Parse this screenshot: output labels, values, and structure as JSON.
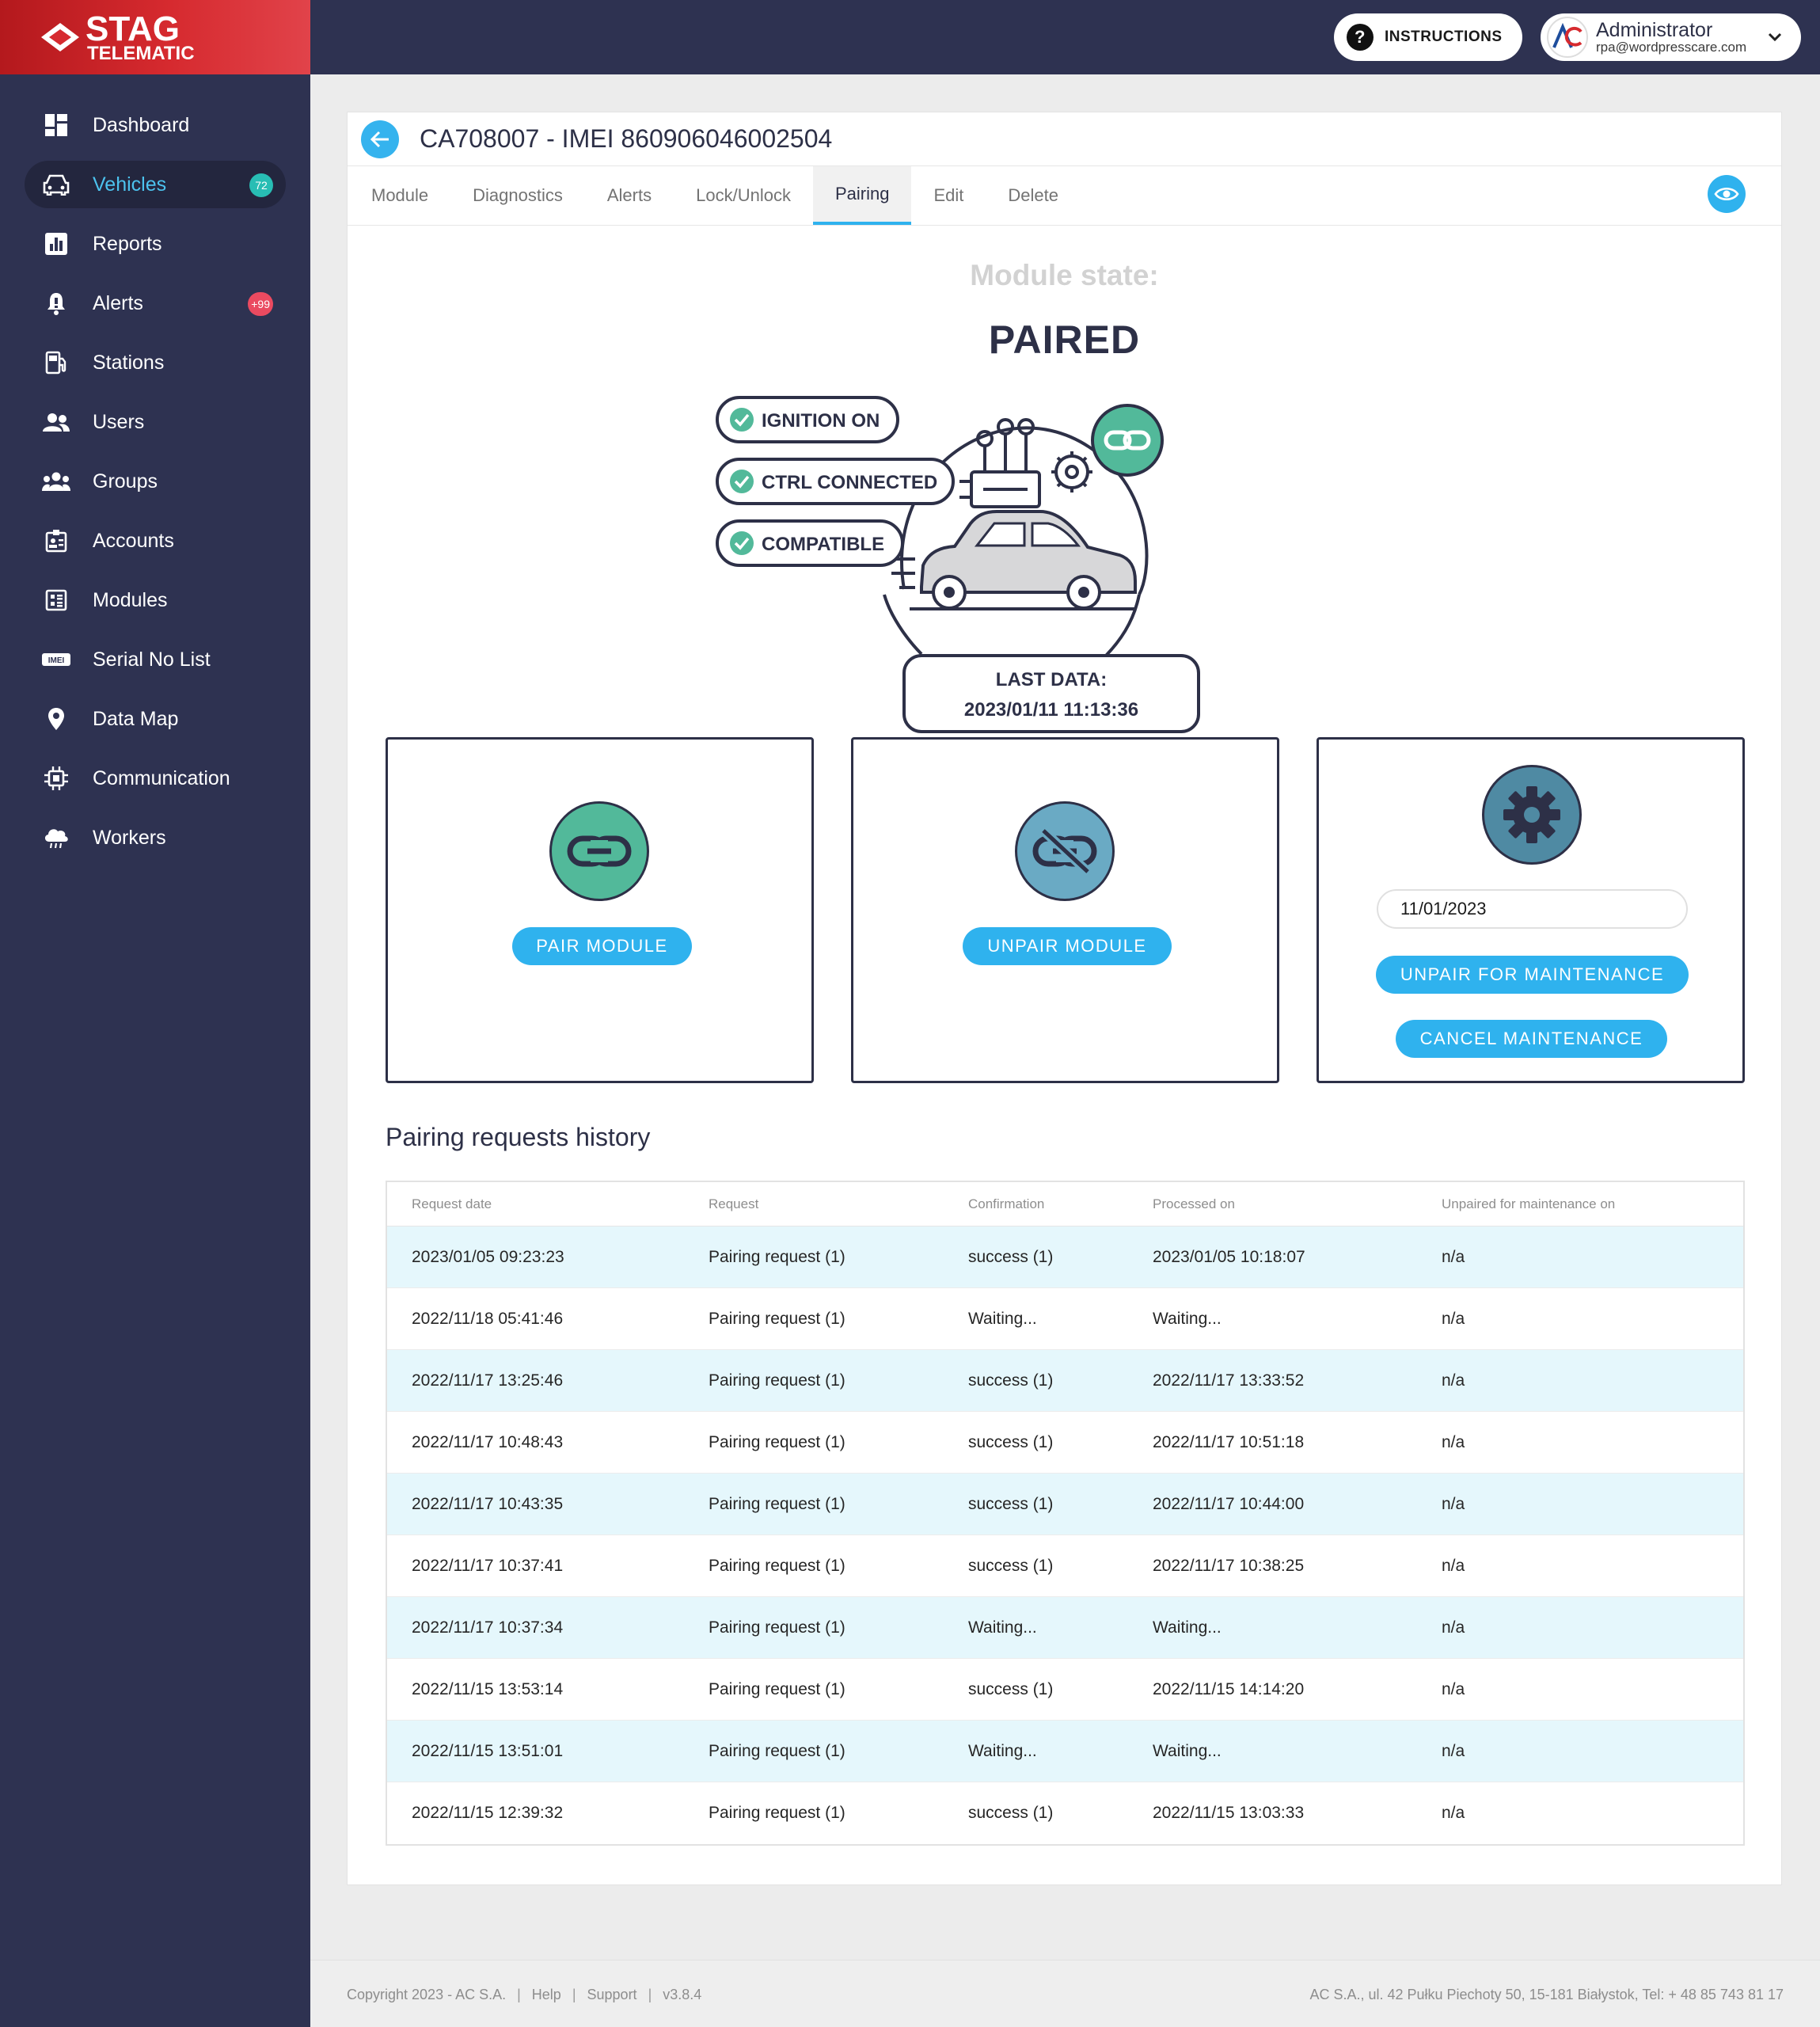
{
  "brand": {
    "line1": "STAG",
    "line2": "TELEMATIC"
  },
  "sidebar": {
    "items": [
      {
        "label": "Dashboard",
        "icon": "dashboard-icon"
      },
      {
        "label": "Vehicles",
        "icon": "car-icon",
        "badge": "72",
        "active": true
      },
      {
        "label": "Reports",
        "icon": "bar-chart-icon"
      },
      {
        "label": "Alerts",
        "icon": "bell-icon",
        "badge": "+99"
      },
      {
        "label": "Stations",
        "icon": "fuel-station-icon"
      },
      {
        "label": "Users",
        "icon": "users-icon"
      },
      {
        "label": "Groups",
        "icon": "groups-icon"
      },
      {
        "label": "Accounts",
        "icon": "id-card-icon"
      },
      {
        "label": "Modules",
        "icon": "module-icon"
      },
      {
        "label": "Serial No List",
        "icon": "imei-icon"
      },
      {
        "label": "Data Map",
        "icon": "map-pin-icon"
      },
      {
        "label": "Communication",
        "icon": "chip-icon"
      },
      {
        "label": "Workers",
        "icon": "cloud-icon"
      }
    ],
    "imei_icon_text": "IMEI"
  },
  "topbar": {
    "instructions_label": "INSTRUCTIONS",
    "user_name": "Administrator",
    "user_email": "rpa@wordpresscare.com"
  },
  "page": {
    "title": "CA708007 - IMEI 860906046002504",
    "tabs": [
      "Module",
      "Diagnostics",
      "Alerts",
      "Lock/Unlock",
      "Pairing",
      "Edit",
      "Delete"
    ],
    "active_tab": "Pairing"
  },
  "module_state": {
    "label": "Module state:",
    "value": "PAIRED",
    "checks": [
      "IGNITION ON",
      "CTRL CONNECTED",
      "COMPATIBLE"
    ],
    "last_data_label": "LAST DATA:",
    "last_data_value": "2023/01/11 11:13:36"
  },
  "actions": {
    "pair_label": "PAIR MODULE",
    "unpair_label": "UNPAIR MODULE",
    "maintenance_date": "11/01/2023",
    "unpair_maintenance_label": "UNPAIR FOR MAINTENANCE",
    "cancel_maintenance_label": "CANCEL MAINTENANCE"
  },
  "history": {
    "title": "Pairing requests history",
    "columns": [
      "Request date",
      "Request",
      "Confirmation",
      "Processed on",
      "Unpaired for maintenance on"
    ],
    "rows": [
      [
        "2023/01/05 09:23:23",
        "Pairing request (1)",
        "success (1)",
        "2023/01/05 10:18:07",
        "n/a"
      ],
      [
        "2022/11/18 05:41:46",
        "Pairing request (1)",
        "Waiting...",
        "Waiting...",
        "n/a"
      ],
      [
        "2022/11/17 13:25:46",
        "Pairing request (1)",
        "success (1)",
        "2022/11/17 13:33:52",
        "n/a"
      ],
      [
        "2022/11/17 10:48:43",
        "Pairing request (1)",
        "success (1)",
        "2022/11/17 10:51:18",
        "n/a"
      ],
      [
        "2022/11/17 10:43:35",
        "Pairing request (1)",
        "success (1)",
        "2022/11/17 10:44:00",
        "n/a"
      ],
      [
        "2022/11/17 10:37:41",
        "Pairing request (1)",
        "success (1)",
        "2022/11/17 10:38:25",
        "n/a"
      ],
      [
        "2022/11/17 10:37:34",
        "Pairing request (1)",
        "Waiting...",
        "Waiting...",
        "n/a"
      ],
      [
        "2022/11/15 13:53:14",
        "Pairing request (1)",
        "success (1)",
        "2022/11/15 14:14:20",
        "n/a"
      ],
      [
        "2022/11/15 13:51:01",
        "Pairing request (1)",
        "Waiting...",
        "Waiting...",
        "n/a"
      ],
      [
        "2022/11/15 12:39:32",
        "Pairing request (1)",
        "success (1)",
        "2022/11/15 13:03:33",
        "n/a"
      ]
    ]
  },
  "footer": {
    "copyright": "Copyright 2023 - AC S.A.",
    "help": "Help",
    "support": "Support",
    "version": "v3.8.4",
    "address": "AC S.A., ul. 42 Pułku Piechoty 50, 15-181 Białystok, Tel: + 48 85 743 81 17"
  },
  "colors": {
    "sidebar": "#2e3251",
    "accent": "#2fb2ee",
    "pair_green": "#52b99a",
    "unpair_blue": "#6aaac4",
    "gear_blue": "#4f8aa3",
    "brand_red": "#d62a2f"
  }
}
